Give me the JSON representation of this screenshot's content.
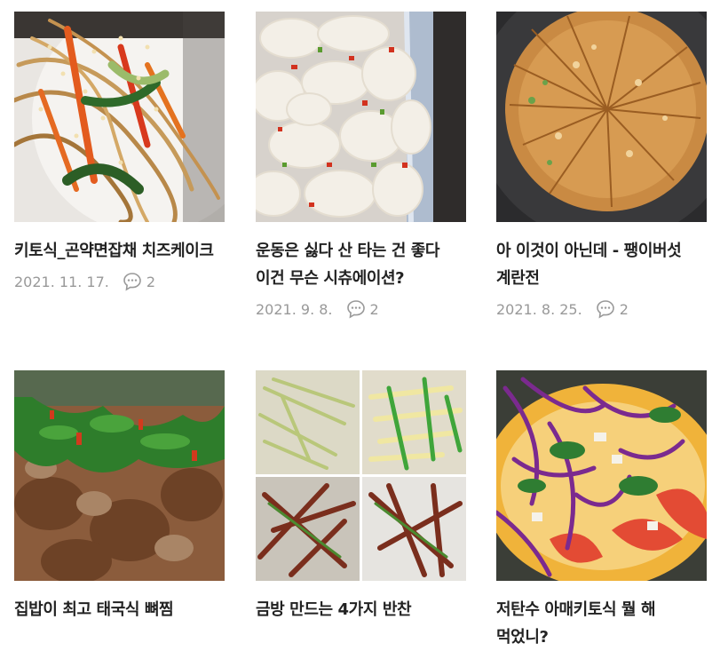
{
  "posts": [
    {
      "title": "키토식_곤약면잡채 치즈케이크",
      "date": "2021. 11. 17.",
      "comments": "2"
    },
    {
      "title": "운동은 싫다 산 타는 건 좋다 이건 무슨 시츄에이션?",
      "date": "2021. 9. 8.",
      "comments": "2"
    },
    {
      "title": "아 이것이 아닌데 - 팽이버섯 계란전",
      "date": "2021. 8. 25.",
      "comments": "2"
    },
    {
      "title": "집밥이 최고 태국식 뼈찜",
      "date": "",
      "comments": ""
    },
    {
      "title": "금방 만드는 4가지 반찬",
      "date": "",
      "comments": ""
    },
    {
      "title": "저탄수 아매키토식 뭘 해 먹었니?",
      "date": "",
      "comments": ""
    }
  ],
  "icons": {
    "comment": "speech-bubble-icon"
  },
  "colors": {
    "title": "#222222",
    "meta": "#999999",
    "background": "#ffffff"
  }
}
